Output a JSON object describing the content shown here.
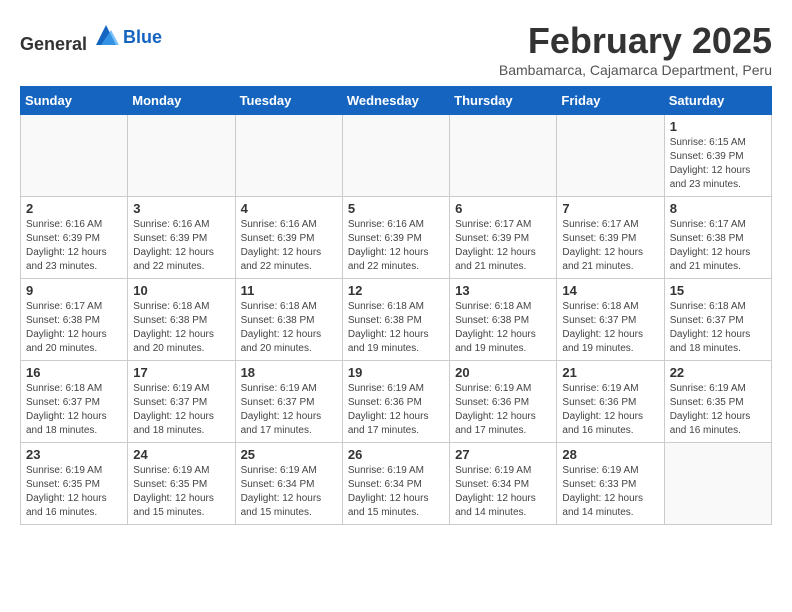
{
  "logo": {
    "general": "General",
    "blue": "Blue"
  },
  "header": {
    "month": "February 2025",
    "location": "Bambamarca, Cajamarca Department, Peru"
  },
  "weekdays": [
    "Sunday",
    "Monday",
    "Tuesday",
    "Wednesday",
    "Thursday",
    "Friday",
    "Saturday"
  ],
  "weeks": [
    [
      {
        "day": "",
        "info": ""
      },
      {
        "day": "",
        "info": ""
      },
      {
        "day": "",
        "info": ""
      },
      {
        "day": "",
        "info": ""
      },
      {
        "day": "",
        "info": ""
      },
      {
        "day": "",
        "info": ""
      },
      {
        "day": "1",
        "info": "Sunrise: 6:15 AM\nSunset: 6:39 PM\nDaylight: 12 hours\nand 23 minutes."
      }
    ],
    [
      {
        "day": "2",
        "info": "Sunrise: 6:16 AM\nSunset: 6:39 PM\nDaylight: 12 hours\nand 23 minutes."
      },
      {
        "day": "3",
        "info": "Sunrise: 6:16 AM\nSunset: 6:39 PM\nDaylight: 12 hours\nand 22 minutes."
      },
      {
        "day": "4",
        "info": "Sunrise: 6:16 AM\nSunset: 6:39 PM\nDaylight: 12 hours\nand 22 minutes."
      },
      {
        "day": "5",
        "info": "Sunrise: 6:16 AM\nSunset: 6:39 PM\nDaylight: 12 hours\nand 22 minutes."
      },
      {
        "day": "6",
        "info": "Sunrise: 6:17 AM\nSunset: 6:39 PM\nDaylight: 12 hours\nand 21 minutes."
      },
      {
        "day": "7",
        "info": "Sunrise: 6:17 AM\nSunset: 6:39 PM\nDaylight: 12 hours\nand 21 minutes."
      },
      {
        "day": "8",
        "info": "Sunrise: 6:17 AM\nSunset: 6:38 PM\nDaylight: 12 hours\nand 21 minutes."
      }
    ],
    [
      {
        "day": "9",
        "info": "Sunrise: 6:17 AM\nSunset: 6:38 PM\nDaylight: 12 hours\nand 20 minutes."
      },
      {
        "day": "10",
        "info": "Sunrise: 6:18 AM\nSunset: 6:38 PM\nDaylight: 12 hours\nand 20 minutes."
      },
      {
        "day": "11",
        "info": "Sunrise: 6:18 AM\nSunset: 6:38 PM\nDaylight: 12 hours\nand 20 minutes."
      },
      {
        "day": "12",
        "info": "Sunrise: 6:18 AM\nSunset: 6:38 PM\nDaylight: 12 hours\nand 19 minutes."
      },
      {
        "day": "13",
        "info": "Sunrise: 6:18 AM\nSunset: 6:38 PM\nDaylight: 12 hours\nand 19 minutes."
      },
      {
        "day": "14",
        "info": "Sunrise: 6:18 AM\nSunset: 6:37 PM\nDaylight: 12 hours\nand 19 minutes."
      },
      {
        "day": "15",
        "info": "Sunrise: 6:18 AM\nSunset: 6:37 PM\nDaylight: 12 hours\nand 18 minutes."
      }
    ],
    [
      {
        "day": "16",
        "info": "Sunrise: 6:18 AM\nSunset: 6:37 PM\nDaylight: 12 hours\nand 18 minutes."
      },
      {
        "day": "17",
        "info": "Sunrise: 6:19 AM\nSunset: 6:37 PM\nDaylight: 12 hours\nand 18 minutes."
      },
      {
        "day": "18",
        "info": "Sunrise: 6:19 AM\nSunset: 6:37 PM\nDaylight: 12 hours\nand 17 minutes."
      },
      {
        "day": "19",
        "info": "Sunrise: 6:19 AM\nSunset: 6:36 PM\nDaylight: 12 hours\nand 17 minutes."
      },
      {
        "day": "20",
        "info": "Sunrise: 6:19 AM\nSunset: 6:36 PM\nDaylight: 12 hours\nand 17 minutes."
      },
      {
        "day": "21",
        "info": "Sunrise: 6:19 AM\nSunset: 6:36 PM\nDaylight: 12 hours\nand 16 minutes."
      },
      {
        "day": "22",
        "info": "Sunrise: 6:19 AM\nSunset: 6:35 PM\nDaylight: 12 hours\nand 16 minutes."
      }
    ],
    [
      {
        "day": "23",
        "info": "Sunrise: 6:19 AM\nSunset: 6:35 PM\nDaylight: 12 hours\nand 16 minutes."
      },
      {
        "day": "24",
        "info": "Sunrise: 6:19 AM\nSunset: 6:35 PM\nDaylight: 12 hours\nand 15 minutes."
      },
      {
        "day": "25",
        "info": "Sunrise: 6:19 AM\nSunset: 6:34 PM\nDaylight: 12 hours\nand 15 minutes."
      },
      {
        "day": "26",
        "info": "Sunrise: 6:19 AM\nSunset: 6:34 PM\nDaylight: 12 hours\nand 15 minutes."
      },
      {
        "day": "27",
        "info": "Sunrise: 6:19 AM\nSunset: 6:34 PM\nDaylight: 12 hours\nand 14 minutes."
      },
      {
        "day": "28",
        "info": "Sunrise: 6:19 AM\nSunset: 6:33 PM\nDaylight: 12 hours\nand 14 minutes."
      },
      {
        "day": "",
        "info": ""
      }
    ]
  ]
}
